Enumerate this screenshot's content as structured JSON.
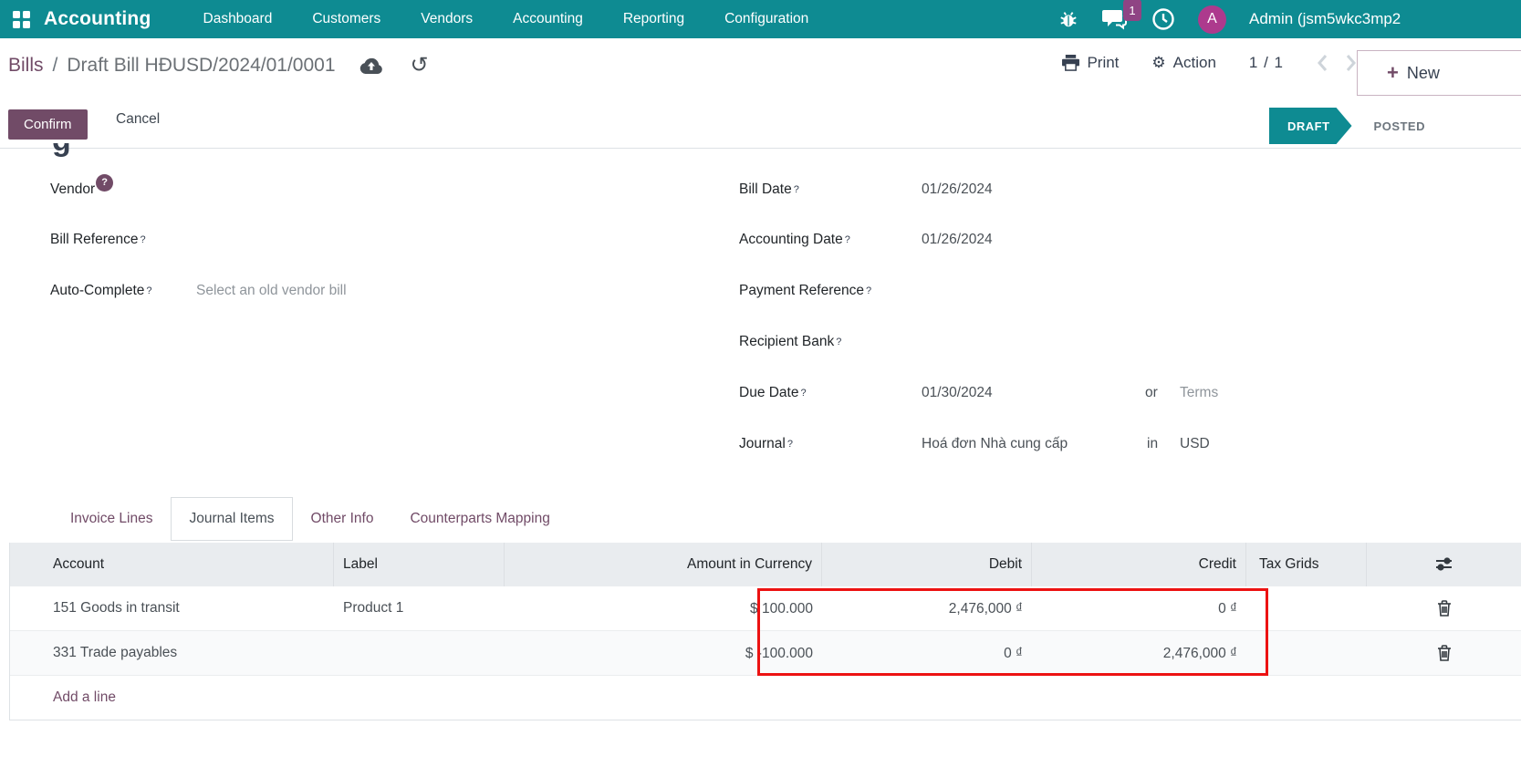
{
  "colors": {
    "navbar_teal": "#0e8b92",
    "brand_purple": "#714b67",
    "avatar_magenta": "#ad3a8d",
    "badge_purple": "#8f4484",
    "draft_badge_teal": "#0e8b92",
    "highlight_red": "#ec1212",
    "table_header_bg": "#e9ecef"
  },
  "nav": {
    "app_name": "Accounting",
    "items": [
      "Dashboard",
      "Customers",
      "Vendors",
      "Accounting",
      "Reporting",
      "Configuration"
    ],
    "message_badge": "1",
    "avatar_initial": "A",
    "user_label": "Admin (jsm5wkc3mp2"
  },
  "breadcrumb": {
    "parent": "Bills",
    "separator": "/",
    "current": "Draft Bill HĐUSD/2024/01/0001"
  },
  "control_panel": {
    "print_label": "Print",
    "action_label": "Action",
    "gear_glyph": "⚙",
    "pager": "1 / 1",
    "plus": "+",
    "new_label": "New",
    "undo_glyph": "↺"
  },
  "statusbar": {
    "confirm_label": "Confirm",
    "cancel_label": "Cancel",
    "draft_label": "DRAFT",
    "posted_label": "POSTED"
  },
  "form": {
    "heading_fragment": "g",
    "vendor": {
      "label": "Vendor",
      "help": "?"
    },
    "bill_reference": {
      "label": "Bill Reference",
      "help": "?"
    },
    "auto_complete": {
      "label": "Auto-Complete",
      "help": "?",
      "placeholder": "Select an old vendor bill"
    },
    "bill_date": {
      "label": "Bill Date",
      "help": "?",
      "value": "01/26/2024"
    },
    "accounting_date": {
      "label": "Accounting Date",
      "help": "?",
      "value": "01/26/2024"
    },
    "payment_reference": {
      "label": "Payment Reference",
      "help": "?",
      "value": ""
    },
    "recipient_bank": {
      "label": "Recipient Bank",
      "help": "?",
      "value": ""
    },
    "due_date": {
      "label": "Due Date",
      "help": "?",
      "value": "01/30/2024",
      "or_text": "or",
      "terms_placeholder": "Terms"
    },
    "journal": {
      "label": "Journal",
      "help": "?",
      "value": "Hoá đơn Nhà cung cấp",
      "in_text": "in",
      "currency": "USD"
    }
  },
  "tabs": [
    {
      "label": "Invoice Lines"
    },
    {
      "label": "Journal Items",
      "active": true
    },
    {
      "label": "Other Info"
    },
    {
      "label": "Counterparts Mapping"
    }
  ],
  "table": {
    "headers": {
      "account": "Account",
      "label": "Label",
      "amount": "Amount in Currency",
      "debit": "Debit",
      "credit": "Credit",
      "tax_grids": "Tax Grids"
    },
    "rows": [
      {
        "account": "151 Goods in transit",
        "label": "Product 1",
        "amount": "$ 100.000",
        "debit": "2,476,000 ₫",
        "credit": "0 ₫",
        "tax_grids": ""
      },
      {
        "account": "331 Trade payables",
        "label": "",
        "amount": "$ -100.000",
        "debit": "0 ₫",
        "credit": "2,476,000 ₫",
        "tax_grids": ""
      }
    ],
    "add_line_label": "Add a line"
  }
}
